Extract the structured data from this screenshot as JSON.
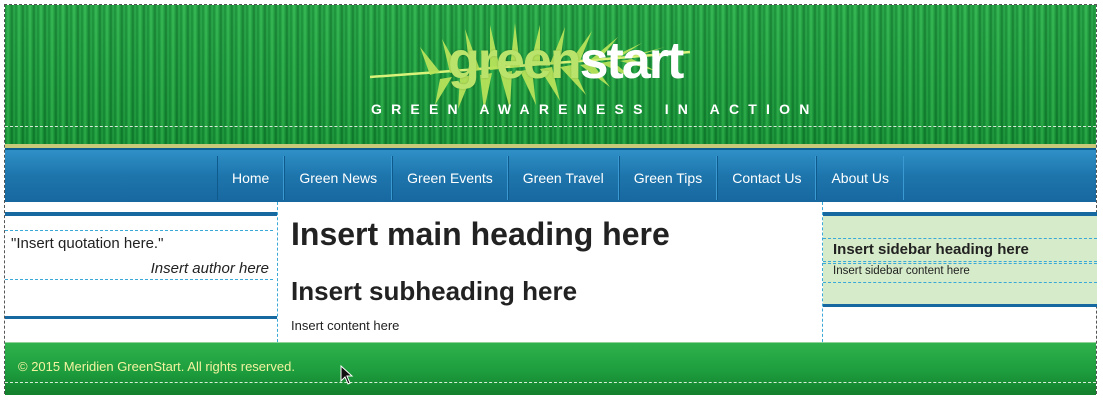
{
  "header": {
    "logo_green": "green",
    "logo_start": "start",
    "tagline": "GREEN AWARENESS IN ACTION"
  },
  "nav": {
    "items": [
      "Home",
      "Green News",
      "Green Events",
      "Green Travel",
      "Green Tips",
      "Contact Us",
      "About Us"
    ]
  },
  "left_sidebar": {
    "quote": "\"Insert quotation here.\"",
    "author": "Insert author here"
  },
  "main": {
    "heading": "Insert main heading here",
    "subheading": "Insert subheading here",
    "content": "Insert content here"
  },
  "right_sidebar": {
    "heading": "Insert sidebar heading here",
    "content": "Insert sidebar content here"
  },
  "footer": {
    "copyright": "© 2015 Meridien GreenStart. All rights reserved."
  },
  "colors": {
    "header_green": "#1a9c3a",
    "nav_blue": "#1d75ac",
    "sidebar_bg": "#d6ebc9",
    "footer_text": "#f3f3a0"
  }
}
